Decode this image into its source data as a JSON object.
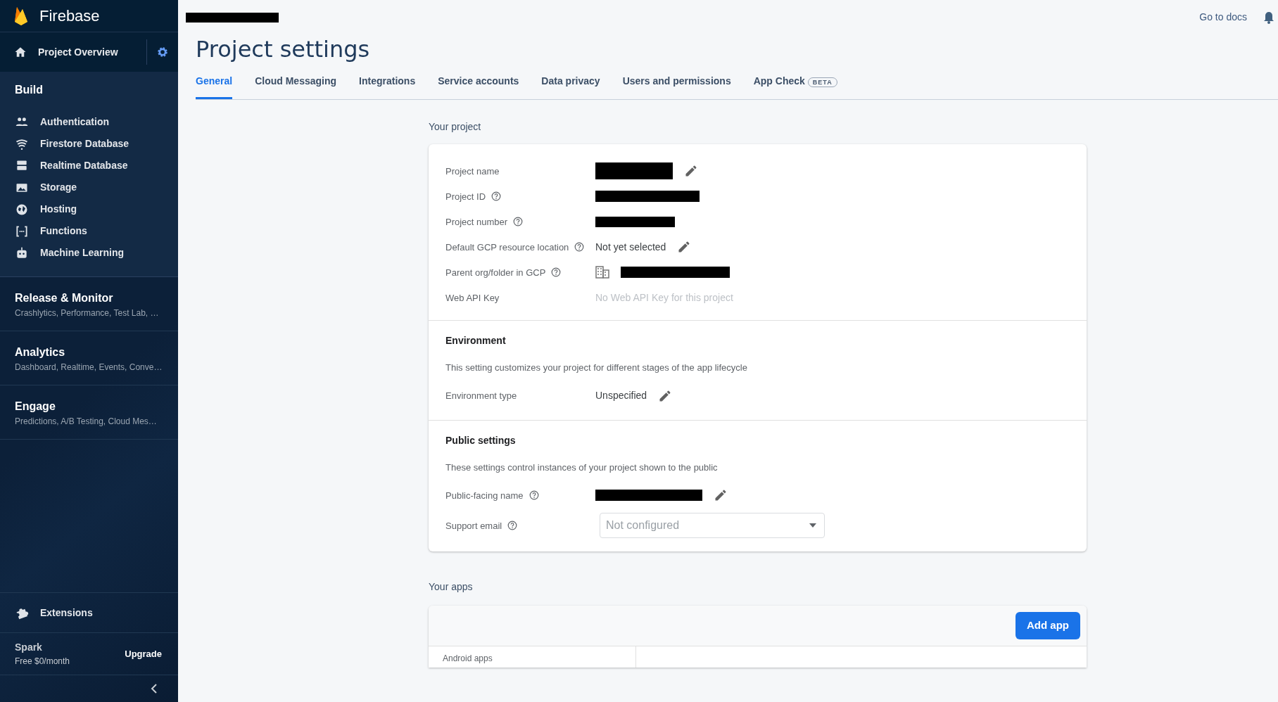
{
  "sidebar": {
    "brand": "Firebase",
    "overview": "Project Overview",
    "build": {
      "title": "Build",
      "items": [
        {
          "label": "Authentication"
        },
        {
          "label": "Firestore Database"
        },
        {
          "label": "Realtime Database"
        },
        {
          "label": "Storage"
        },
        {
          "label": "Hosting"
        },
        {
          "label": "Functions"
        },
        {
          "label": "Machine Learning"
        }
      ]
    },
    "groups": [
      {
        "title": "Release & Monitor",
        "subtitle": "Crashlytics, Performance, Test Lab, …"
      },
      {
        "title": "Analytics",
        "subtitle": "Dashboard, Realtime, Events, Conve…"
      },
      {
        "title": "Engage",
        "subtitle": "Predictions, A/B Testing, Cloud Mes…"
      }
    ],
    "extensions": "Extensions",
    "plan": {
      "name": "Spark",
      "price": "Free $0/month",
      "upgrade": "Upgrade"
    }
  },
  "header": {
    "docs_link": "Go to docs"
  },
  "title": "Project settings",
  "tabs": [
    {
      "label": "General",
      "selected": true
    },
    {
      "label": "Cloud Messaging",
      "selected": false
    },
    {
      "label": "Integrations",
      "selected": false
    },
    {
      "label": "Service accounts",
      "selected": false
    },
    {
      "label": "Data privacy",
      "selected": false
    },
    {
      "label": "Users and permissions",
      "selected": false
    },
    {
      "label": "App Check",
      "selected": false,
      "badge": "BETA"
    }
  ],
  "project": {
    "heading": "Your project",
    "sections": [
      {
        "fields": [
          {
            "label": "Project name",
            "help": false,
            "kind": "redacted",
            "editable": true
          },
          {
            "label": "Project ID",
            "help": true,
            "kind": "redacted",
            "editable": false
          },
          {
            "label": "Project number",
            "help": true,
            "kind": "redacted",
            "editable": false
          },
          {
            "label": "Default GCP resource location",
            "help": true,
            "kind": "text",
            "value": "Not yet selected",
            "editable": true
          },
          {
            "label": "Parent org/folder in GCP",
            "help": true,
            "kind": "org",
            "editable": false
          },
          {
            "label": "Web API Key",
            "help": false,
            "kind": "muted",
            "value": "No Web API Key for this project",
            "editable": false
          }
        ]
      },
      {
        "heading": "Environment",
        "description": "This setting customizes your project for different stages of the app lifecycle",
        "fields": [
          {
            "label": "Environment type",
            "help": false,
            "kind": "text",
            "value": "Unspecified",
            "editable": true
          }
        ]
      },
      {
        "heading": "Public settings",
        "description": "These settings control instances of your project shown to the public",
        "fields": [
          {
            "label": "Public-facing name",
            "help": true,
            "kind": "redacted",
            "editable": true
          },
          {
            "label": "Support email",
            "help": true,
            "kind": "select",
            "placeholder": "Not configured",
            "editable": false
          }
        ]
      }
    ]
  },
  "apps": {
    "heading": "Your apps",
    "add_button": "Add app",
    "list_heading": "Android apps"
  }
}
